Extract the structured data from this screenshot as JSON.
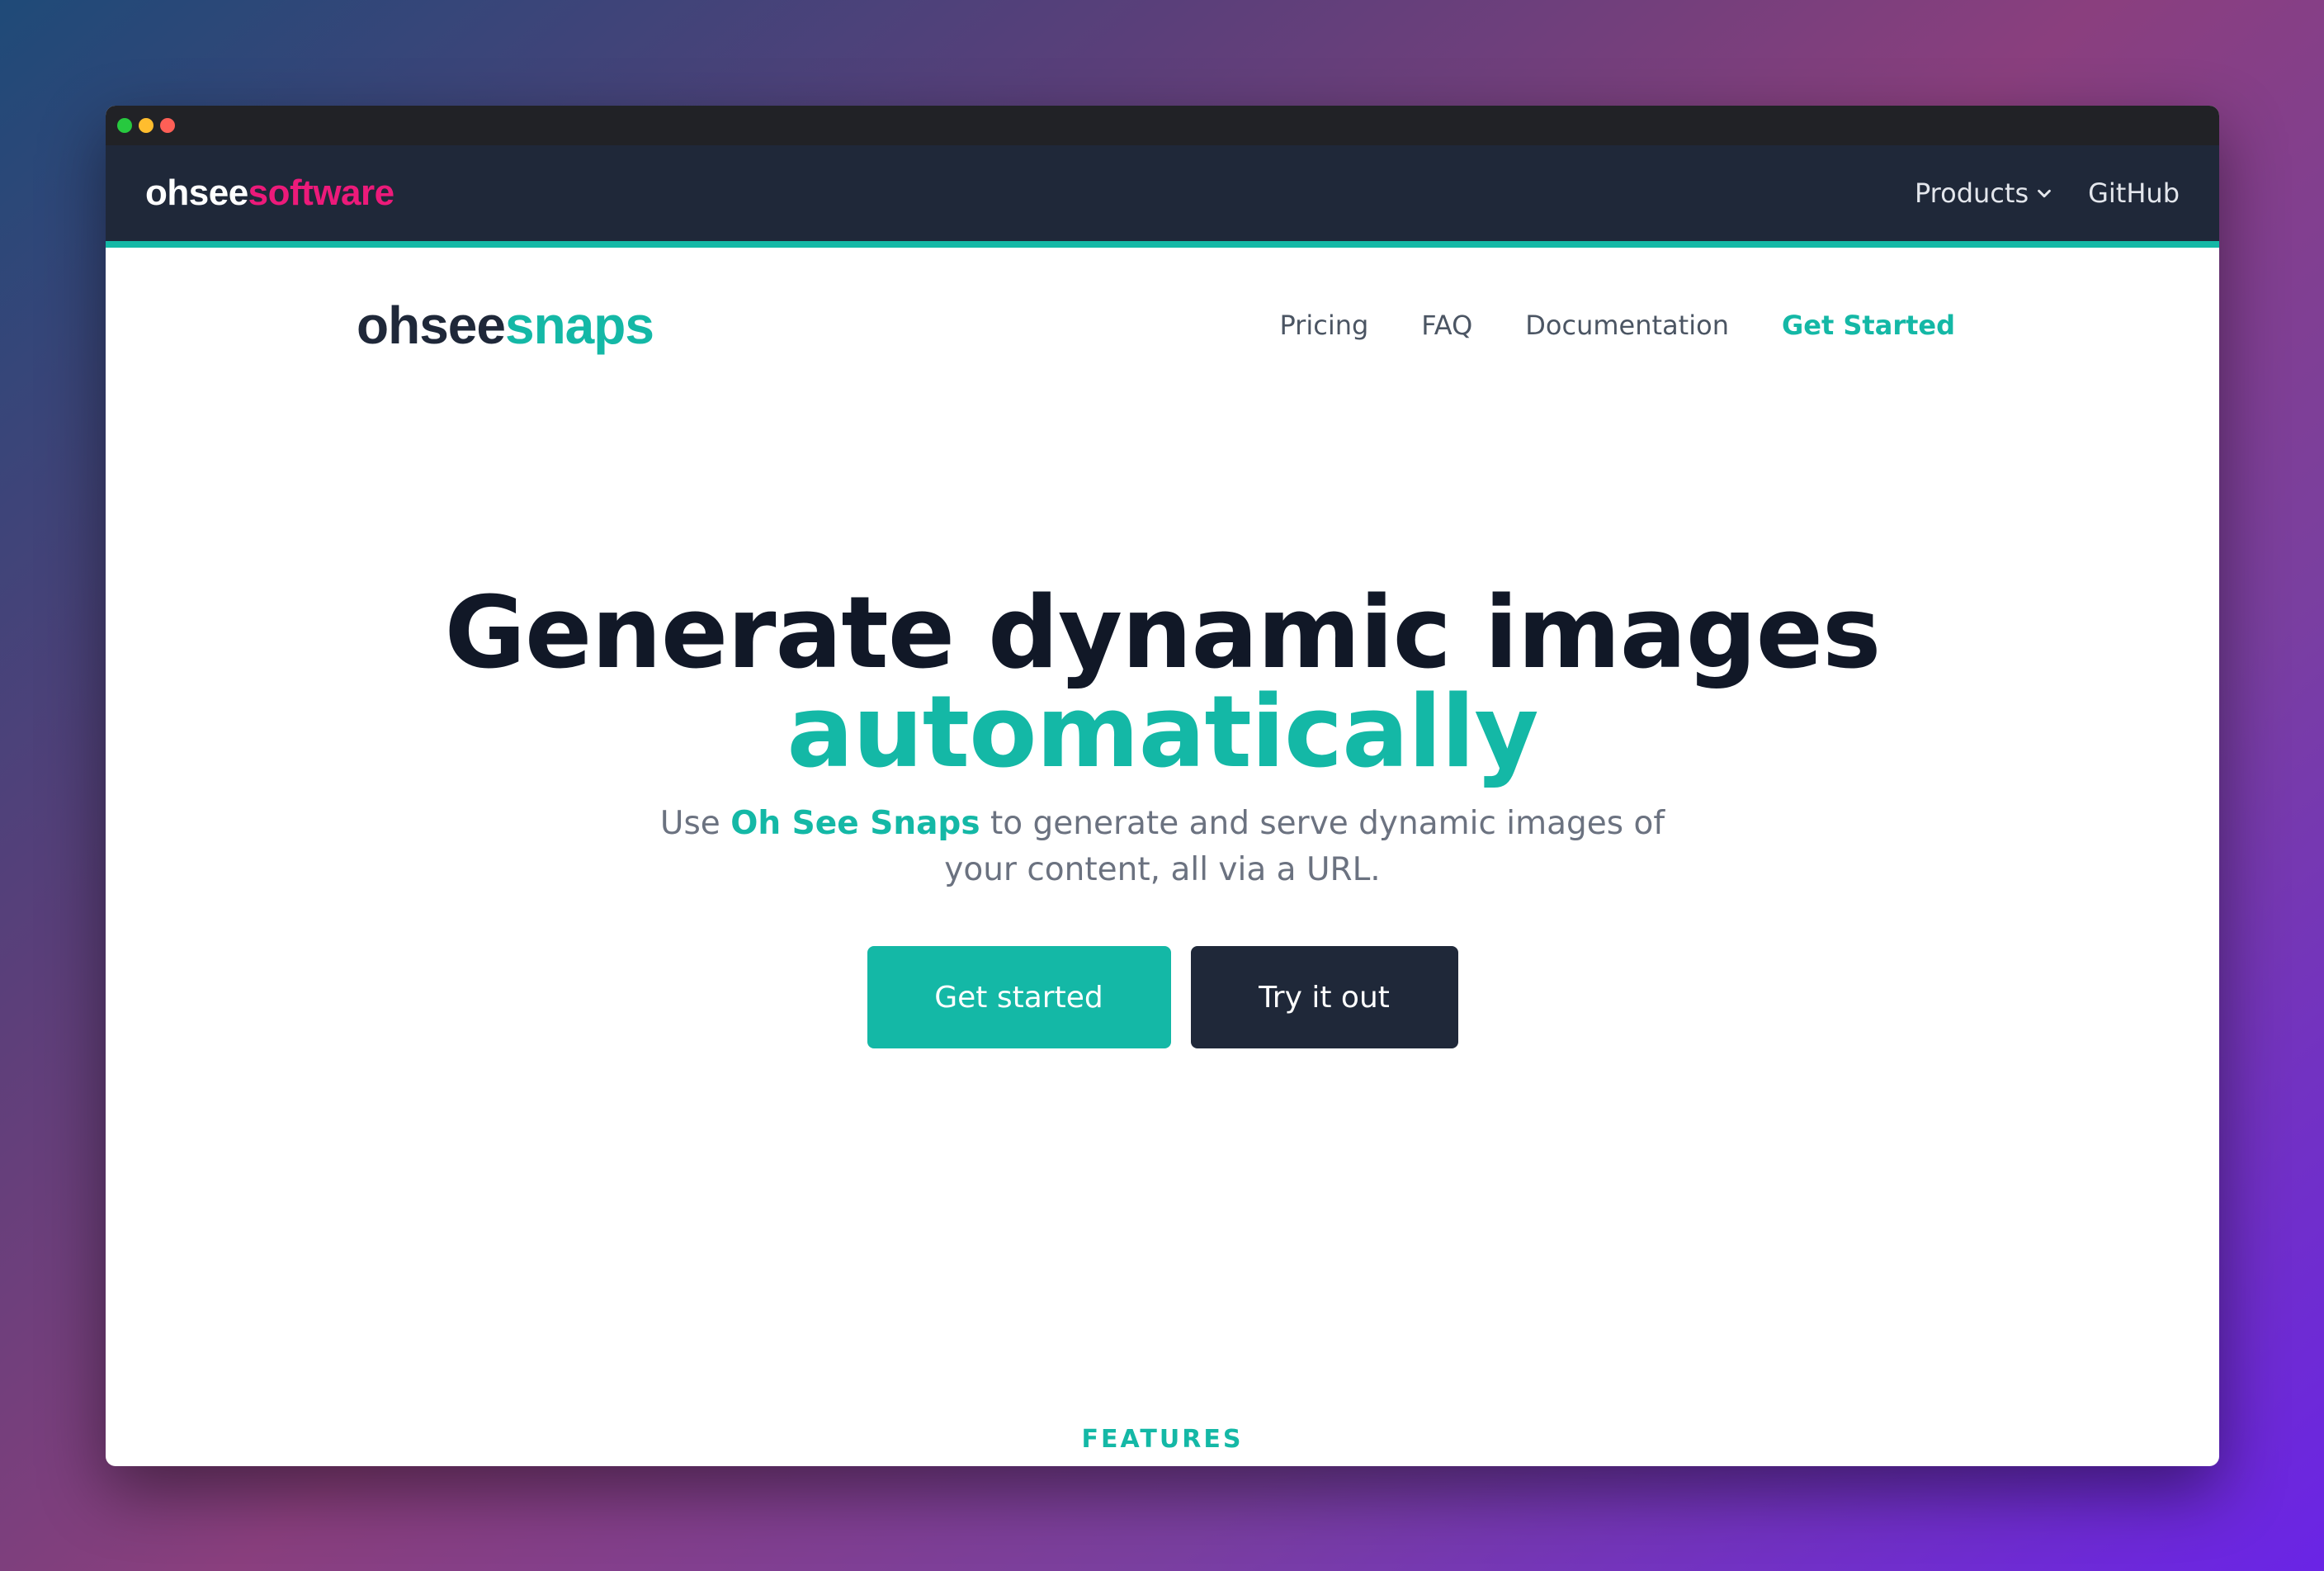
{
  "window": {
    "controls": [
      "green",
      "yellow",
      "red"
    ],
    "control_colors": {
      "green": "#27c93f",
      "yellow": "#ffbd2e",
      "red": "#ff5f56"
    }
  },
  "topnav": {
    "brand_part1": "ohsee",
    "brand_part2": "software",
    "brand_colors": {
      "part1": "#ffffff",
      "part2": "#ec1a7a"
    },
    "products_label": "Products",
    "products_icon": "chevron-down-icon",
    "github_label": "GitHub"
  },
  "sitenav": {
    "brand_part1": "ohsee",
    "brand_part2": "snaps",
    "brand_colors": {
      "part1": "#1f2839",
      "part2": "#14b8a6"
    },
    "links": [
      "Pricing",
      "FAQ",
      "Documentation"
    ],
    "cta_label": "Get Started"
  },
  "hero": {
    "title_line1": "Generate dynamic images",
    "title_line2": "automatically",
    "subtitle_prefix": "Use ",
    "subtitle_brand": "Oh See Snaps",
    "subtitle_suffix": " to generate and serve dynamic images of your content, all via a URL.",
    "primary_button": "Get started",
    "secondary_button": "Try it out"
  },
  "features_label": "FEATURES",
  "colors": {
    "accent": "#14b8a6",
    "dark": "#1f2839",
    "heading": "#111827",
    "muted": "#6b7280"
  }
}
